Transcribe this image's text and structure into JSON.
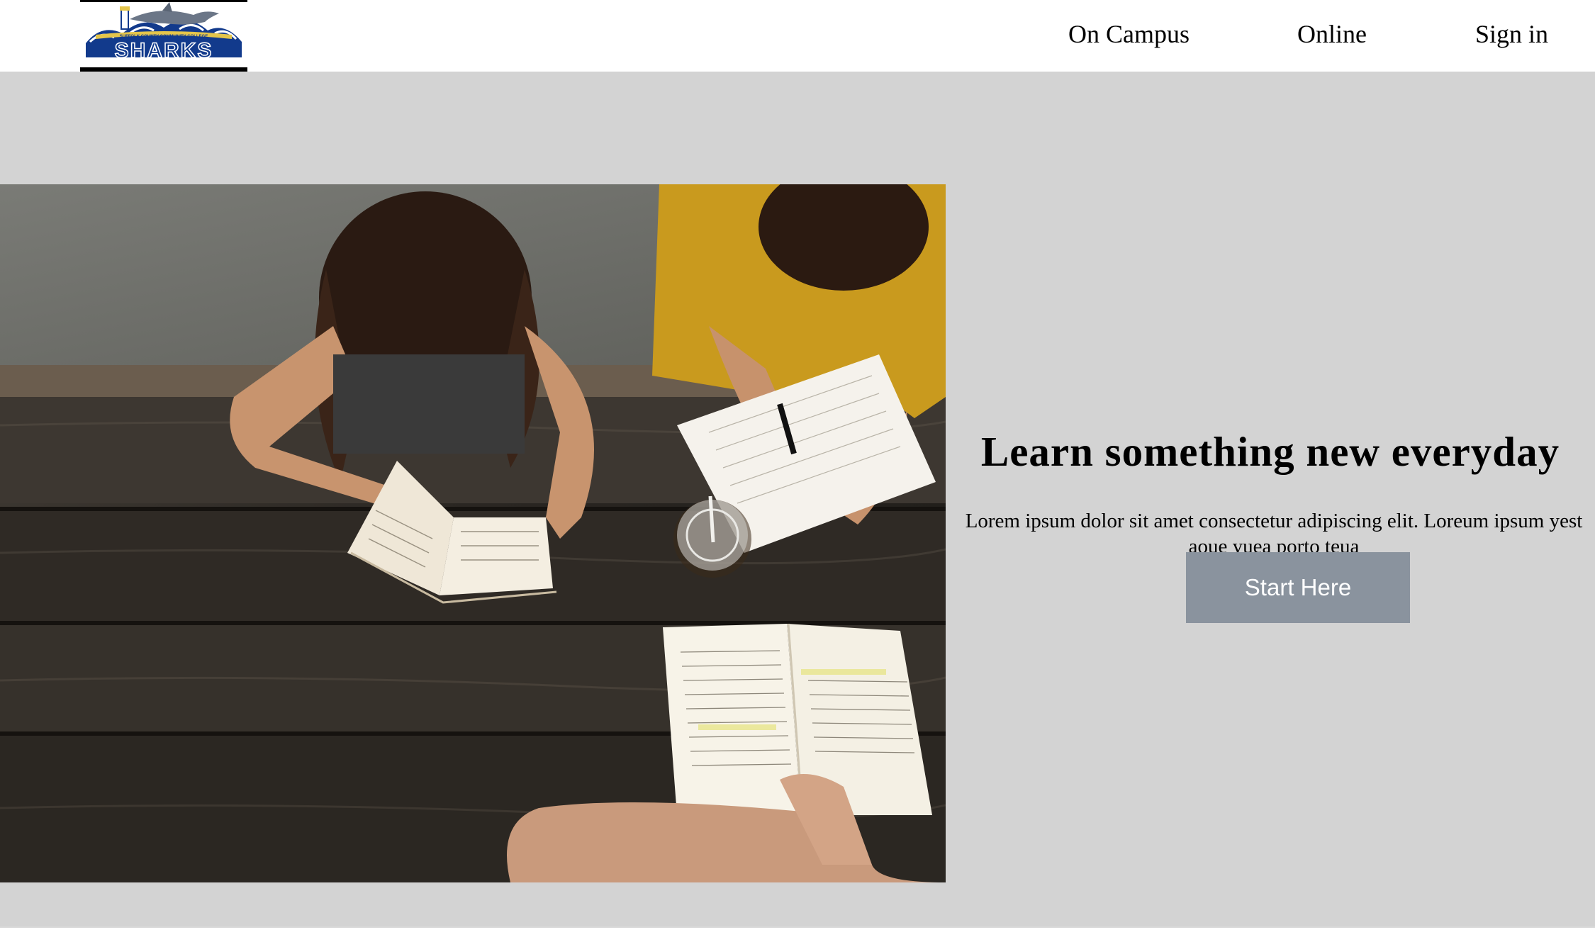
{
  "header": {
    "logo": {
      "text": "SHARKS",
      "subtext": "SUFFOLK COUNTY COMMUNITY COLLEGE",
      "icon": "shark-logo-icon",
      "colors": {
        "navy": "#123a8c",
        "gold": "#e4c54b"
      }
    },
    "nav": [
      {
        "label": "On Campus"
      },
      {
        "label": "Online"
      },
      {
        "label": "Sign in"
      }
    ]
  },
  "hero": {
    "image": {
      "alt": "students-reading-at-picnic-table",
      "icon": "hero-photo"
    },
    "title": "Learn something new everyday",
    "description": "Lorem ipsum dolor sit amet consectetur adipiscing elit. Loreum ipsum yest aoue yuea porto teua",
    "cta_label": "Start Here",
    "colors": {
      "background": "#d3d3d3",
      "button": "#8a939e"
    }
  }
}
